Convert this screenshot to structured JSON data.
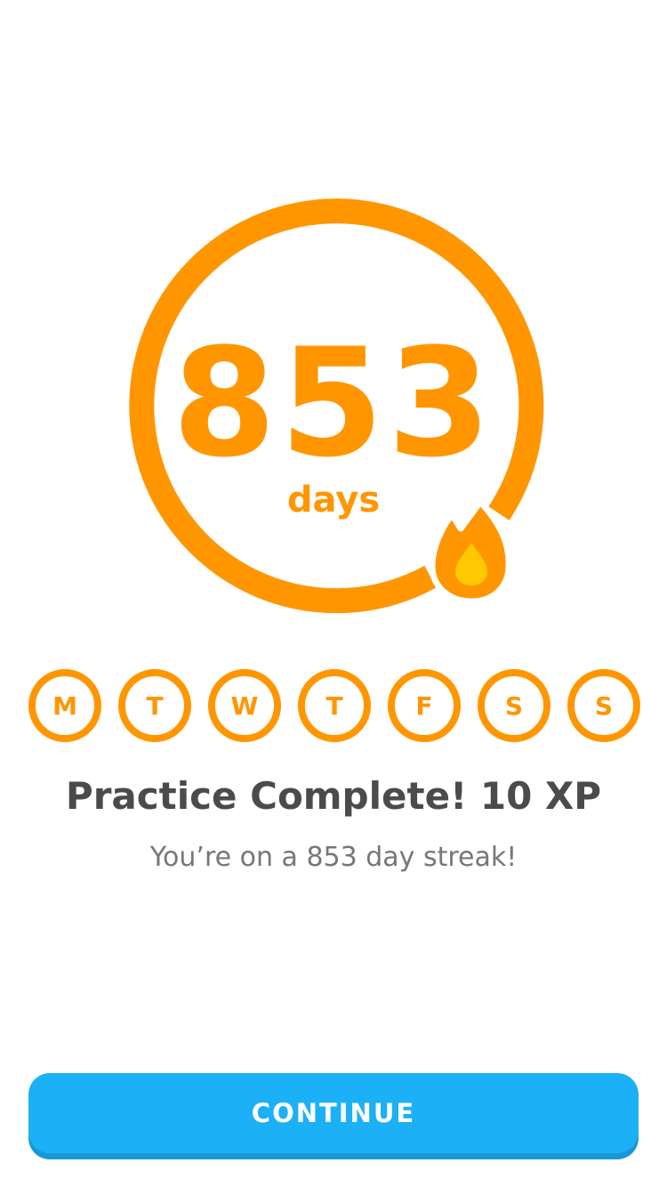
{
  "streak": {
    "count": "853",
    "unit": "days"
  },
  "week": {
    "days": [
      "M",
      "T",
      "W",
      "T",
      "F",
      "S",
      "S"
    ]
  },
  "result": {
    "title": "Practice Complete! 10 XP",
    "subtitle": "You’re on a 853 day streak!"
  },
  "actions": {
    "continue_label": "CONTINUE"
  },
  "colors": {
    "accent": "#FF9600",
    "flame_inner": "#FFC800",
    "title_text": "#4B4B4B",
    "subtitle_text": "#777777",
    "button": "#1CB0F6",
    "button_shadow": "#1899D6"
  }
}
